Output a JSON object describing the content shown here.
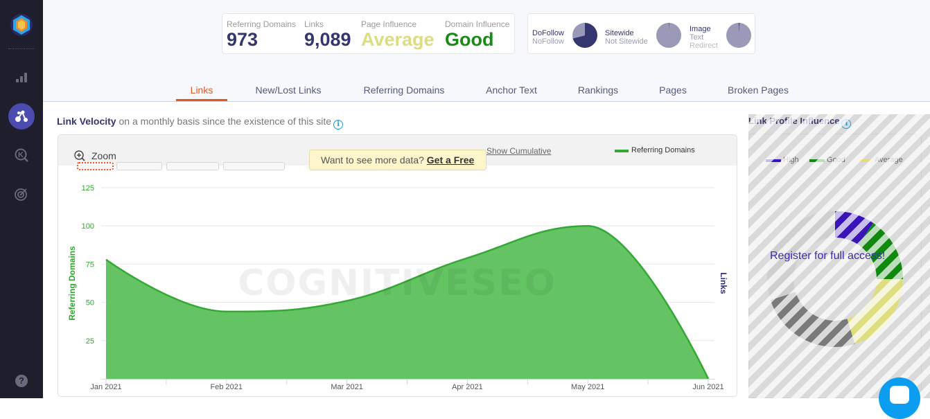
{
  "sidebar": {
    "items": [
      {
        "icon": "app-logo-icon",
        "active": false
      },
      {
        "icon": "bar-chart-icon",
        "active": false
      },
      {
        "icon": "link-graph-icon",
        "active": true
      },
      {
        "icon": "keyword-search-icon",
        "active": false
      },
      {
        "icon": "target-icon",
        "active": false
      },
      {
        "icon": "help-icon",
        "active": false,
        "glyph": "?"
      }
    ]
  },
  "summary": {
    "referring_domains": {
      "label": "Referring Domains",
      "value": "973"
    },
    "links": {
      "label": "Links",
      "value": "9,089"
    },
    "page_influence": {
      "label": "Page Influence",
      "value": "Average",
      "color": "#dcdc82"
    },
    "domain_influence": {
      "label": "Domain Influence",
      "value": "Good",
      "color": "#178a17"
    }
  },
  "pies": [
    {
      "labels": [
        "DoFollow",
        "NoFollow"
      ],
      "values": [
        71,
        29
      ],
      "colors": [
        "#353570",
        "#9a9ab8"
      ]
    },
    {
      "labels": [
        "Sitewide",
        "Not Sitewide"
      ],
      "values": [
        0.5,
        99.5
      ],
      "colors": [
        "#353570",
        "#9a9ab8"
      ]
    },
    {
      "labels": [
        "Image",
        "Text",
        "Redirect"
      ],
      "values": [
        1,
        99,
        0
      ],
      "colors": [
        "#353570",
        "#9a9ab8",
        "#bbbbbb"
      ]
    }
  ],
  "tabs": [
    {
      "label": "Links",
      "active": true
    },
    {
      "label": "New/Lost Links",
      "active": false
    },
    {
      "label": "Referring Domains",
      "active": false
    },
    {
      "label": "Anchor Text",
      "active": false
    },
    {
      "label": "Rankings",
      "active": false
    },
    {
      "label": "Pages",
      "active": false
    },
    {
      "label": "Broken Pages",
      "active": false
    }
  ],
  "section": {
    "title_bold": "Link Velocity",
    "title_rest": " on a monthly basis since the existence of this site",
    "info_glyph": "i"
  },
  "chart_controls": {
    "zoom_label": "Zoom",
    "promo_text": "Want to see more data? ",
    "promo_link": "Get a Free",
    "show_cumulative": "Show Cumulative"
  },
  "chart_data": {
    "type": "area",
    "title": "Link Velocity",
    "categories": [
      "Jan 2021",
      "Feb 2021",
      "Mar 2021",
      "Apr 2021",
      "May 2021",
      "Jun 2021"
    ],
    "series": [
      {
        "name": "Referring Domains",
        "values": [
          78,
          44,
          51,
          79,
          100,
          0
        ],
        "color": "#33a833",
        "fill": "#64c464"
      }
    ],
    "ylabel": "Referring Domains",
    "ylabel_right": "Links",
    "yticks": [
      25,
      50,
      75,
      100,
      125
    ],
    "ylim": [
      0,
      125
    ],
    "grid": true,
    "legend": "top-right",
    "watermark": "COGNITIVESEO"
  },
  "influence": {
    "title": "Link Profile Influence",
    "legend": [
      {
        "label": "High",
        "color": "#3a14b8"
      },
      {
        "label": "Good",
        "color": "#0f8a0f"
      },
      {
        "label": "Average",
        "color": "#dede80"
      }
    ],
    "overlay_text": "Register for full access!",
    "segments": [
      {
        "label": "High",
        "share": 9.5,
        "color": "#3a14b8"
      },
      {
        "label": "Good",
        "share": 15.5,
        "color": "#0f8a0f"
      },
      {
        "label": "Average",
        "share": 20.3,
        "color": "#dede80"
      },
      {
        "label": "",
        "share": 24.7,
        "color": "#7a7a7a"
      },
      {
        "label": "",
        "share": 30.0,
        "color": "#cfcfcf"
      }
    ]
  }
}
